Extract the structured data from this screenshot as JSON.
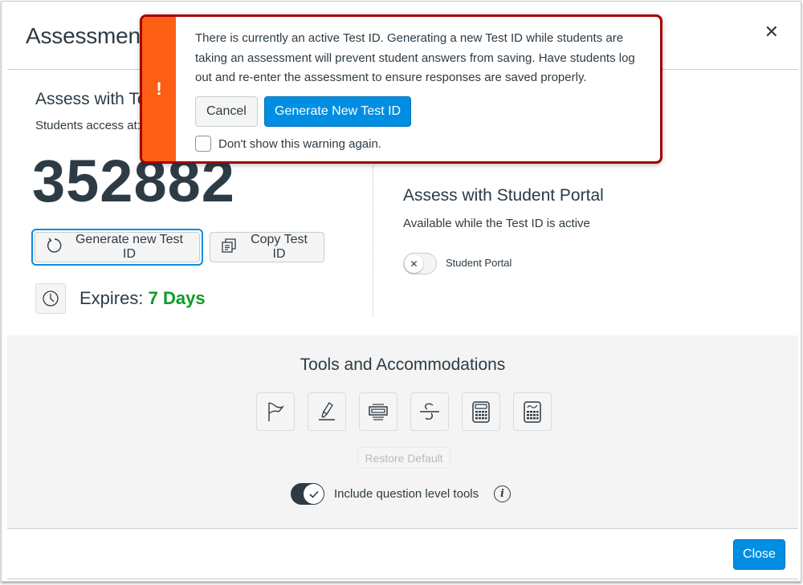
{
  "modal": {
    "title": "Assessment",
    "close_icon": "close-icon",
    "close_button": "Close"
  },
  "test_id_section": {
    "heading": "Assess with Test ID",
    "access_text": "Students access at:",
    "test_id": "352882",
    "generate_button": "Generate new Test ID",
    "generate_icon": "refresh-icon",
    "copy_button": "Copy Test ID",
    "copy_icon": "copy-icon",
    "clock_icon": "clock-icon",
    "expires_label": "Expires:",
    "expires_value": "7 Days",
    "expires_color": "#0a9c29"
  },
  "student_portal": {
    "heading": "Assess with Student Portal",
    "subtext": "Available while the Test ID is active",
    "toggle_label": "Student Portal",
    "toggle_on": false
  },
  "tools": {
    "title": "Tools and Accommodations",
    "items": [
      {
        "name": "flag-icon"
      },
      {
        "name": "highlighter-icon"
      },
      {
        "name": "line-reader-icon"
      },
      {
        "name": "strikethrough-icon"
      },
      {
        "name": "calculator-icon"
      },
      {
        "name": "scientific-calculator-icon"
      }
    ],
    "restore_default": "Restore Default",
    "include_question_tools_label": "Include question level tools",
    "include_question_tools_on": true,
    "info_icon": "info-icon"
  },
  "warning": {
    "icon": "!",
    "message": "There is currently an active Test ID. Generating a new Test ID while students are taking an assessment will prevent student answers from saving. Have students log out and re-enter the assessment to ensure responses are saved properly.",
    "cancel": "Cancel",
    "confirm": "Generate New Test ID",
    "checkbox_label": "Don't show this warning again.",
    "checkbox_checked": false,
    "border_color": "#a30000",
    "bar_color": "#fc5e13"
  },
  "colors": {
    "primary": "#008ee2",
    "text": "#2d3b45"
  }
}
